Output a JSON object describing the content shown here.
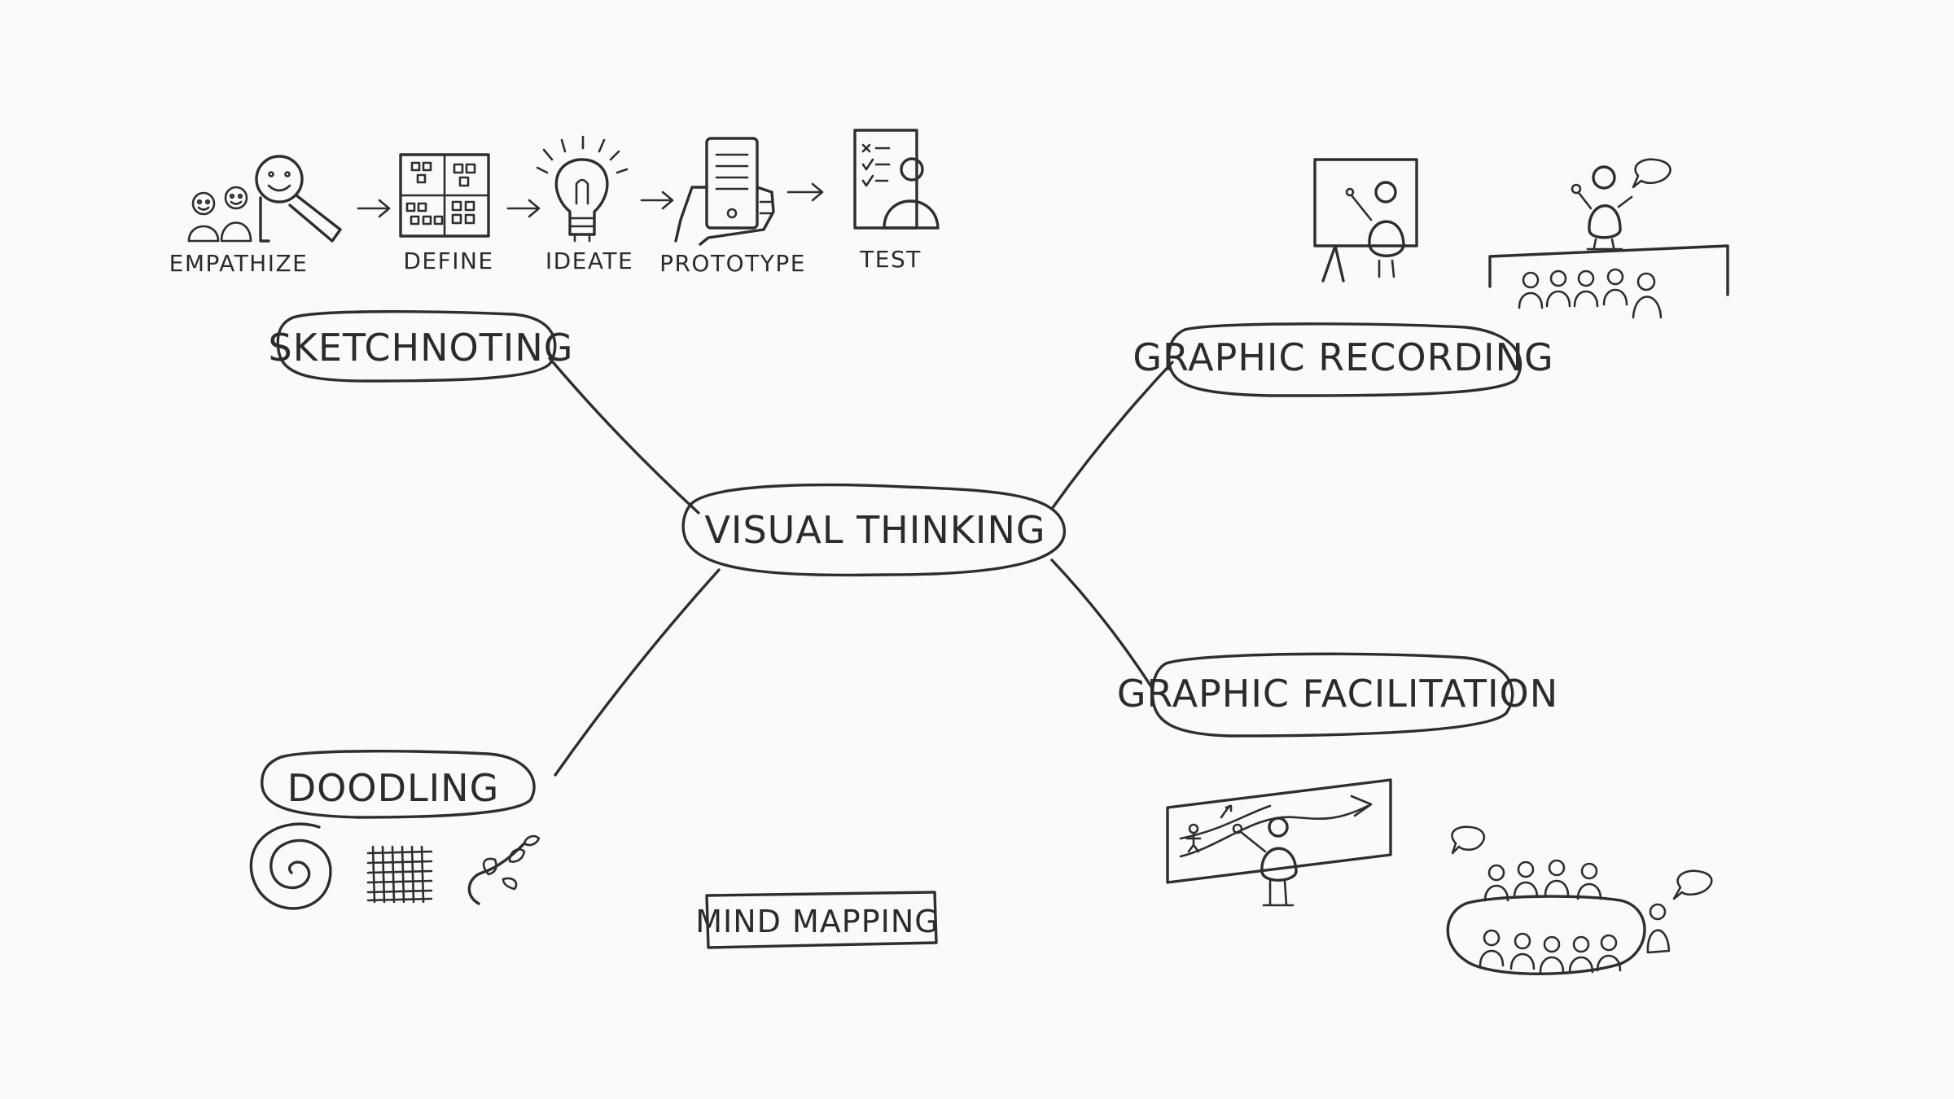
{
  "diagram": {
    "center": {
      "label": "VISUAL THINKING"
    },
    "branches": [
      {
        "id": "sketchnoting",
        "label": "SKETCHNOTING"
      },
      {
        "id": "graphic-recording",
        "label": "GRAPHIC RECORDING"
      },
      {
        "id": "graphic-facilitation",
        "label": "GRAPHIC FACILITATION"
      },
      {
        "id": "doodling",
        "label": "DOODLING"
      }
    ],
    "standalone": {
      "label": "MIND MAPPING"
    },
    "design_thinking_steps": [
      {
        "label": "EMPATHIZE",
        "icon": "people-magnifier-icon"
      },
      {
        "label": "DEFINE",
        "icon": "grid-notes-icon"
      },
      {
        "label": "IDEATE",
        "icon": "lightbulb-icon"
      },
      {
        "label": "PROTOTYPE",
        "icon": "phone-in-hand-icon"
      },
      {
        "label": "TEST",
        "icon": "checklist-person-icon"
      }
    ]
  },
  "colors": {
    "ink": "#2e2e2e",
    "paper": "#fafafa"
  }
}
